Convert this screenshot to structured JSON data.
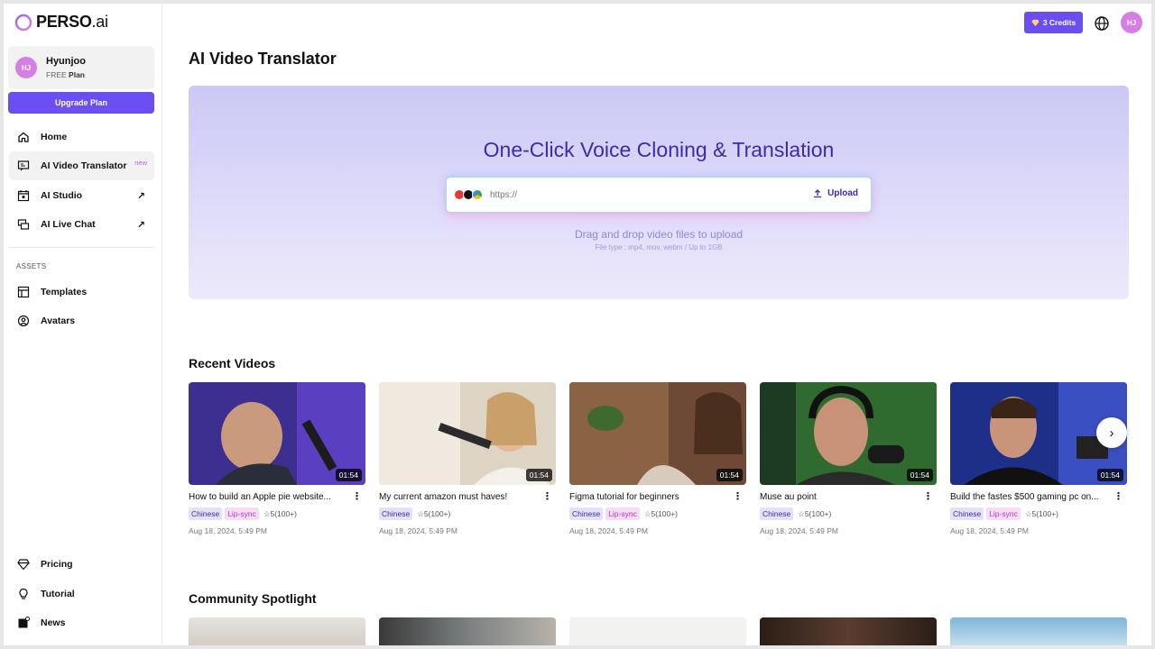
{
  "brand": {
    "name": "PERSO",
    "suffix": ".ai"
  },
  "user": {
    "initials": "HJ",
    "name": "Hyunjoo",
    "plan_tier": "FREE",
    "plan_word": "Plan"
  },
  "sidebar": {
    "upgrade_label": "Upgrade Plan",
    "items": [
      {
        "label": "Home",
        "icon": "home-icon"
      },
      {
        "label": "AI Video Translator",
        "icon": "translate-icon",
        "badge": "new"
      },
      {
        "label": "AI Studio",
        "icon": "studio-icon"
      },
      {
        "label": "AI Live Chat",
        "icon": "chat-icon"
      }
    ],
    "assets_label": "ASSETS",
    "assets": [
      {
        "label": "Templates",
        "icon": "templates-icon"
      },
      {
        "label": "Avatars",
        "icon": "avatar-icon"
      }
    ],
    "footer": [
      {
        "label": "Pricing",
        "icon": "diamond-icon"
      },
      {
        "label": "Tutorial",
        "icon": "lightbulb-icon"
      },
      {
        "label": "News",
        "icon": "news-icon"
      }
    ]
  },
  "topbar": {
    "credits_label": "3 Credits",
    "avatar_initials": "HJ"
  },
  "page": {
    "title": "AI Video Translator"
  },
  "hero": {
    "title": "One-Click Voice Cloning & Translation",
    "url_placeholder": "https://",
    "upload_label": "Upload",
    "drag_text": "Drag and drop video files to upload",
    "file_type_text": "File type : mp4, mov, webm / Up to 1GB"
  },
  "recent": {
    "title": "Recent Videos",
    "videos": [
      {
        "title": "How to build an Apple pie website...",
        "duration": "01:54",
        "language": "Chinese",
        "lip_sync": "Lip-sync",
        "rating": "5(100+)",
        "date": "Aug 18, 2024, 5:49 PM"
      },
      {
        "title": "My current amazon must haves!",
        "duration": "01:54",
        "language": "Chinese",
        "lip_sync": "",
        "rating": "5(100+)",
        "date": "Aug 18, 2024, 5:49 PM"
      },
      {
        "title": "Figma tutorial for beginners",
        "duration": "01:54",
        "language": "Chinese",
        "lip_sync": "Lip-sync",
        "rating": "5(100+)",
        "date": "Aug 18, 2024, 5:49 PM"
      },
      {
        "title": "Muse au point",
        "duration": "01:54",
        "language": "Chinese",
        "lip_sync": "",
        "rating": "5(100+)",
        "date": "Aug 18, 2024, 5:49 PM"
      },
      {
        "title": "Build the fastes $500 gaming pc on...",
        "duration": "01:54",
        "language": "Chinese",
        "lip_sync": "Lip-sync",
        "rating": "5(100+)",
        "date": "Aug 18, 2024, 5:49 PM"
      }
    ]
  },
  "community": {
    "title": "Community Spotlight"
  },
  "colors": {
    "accent": "#6b4ef0",
    "hero_title": "#3f2ba8",
    "lip_sync": "#b23bc6"
  }
}
